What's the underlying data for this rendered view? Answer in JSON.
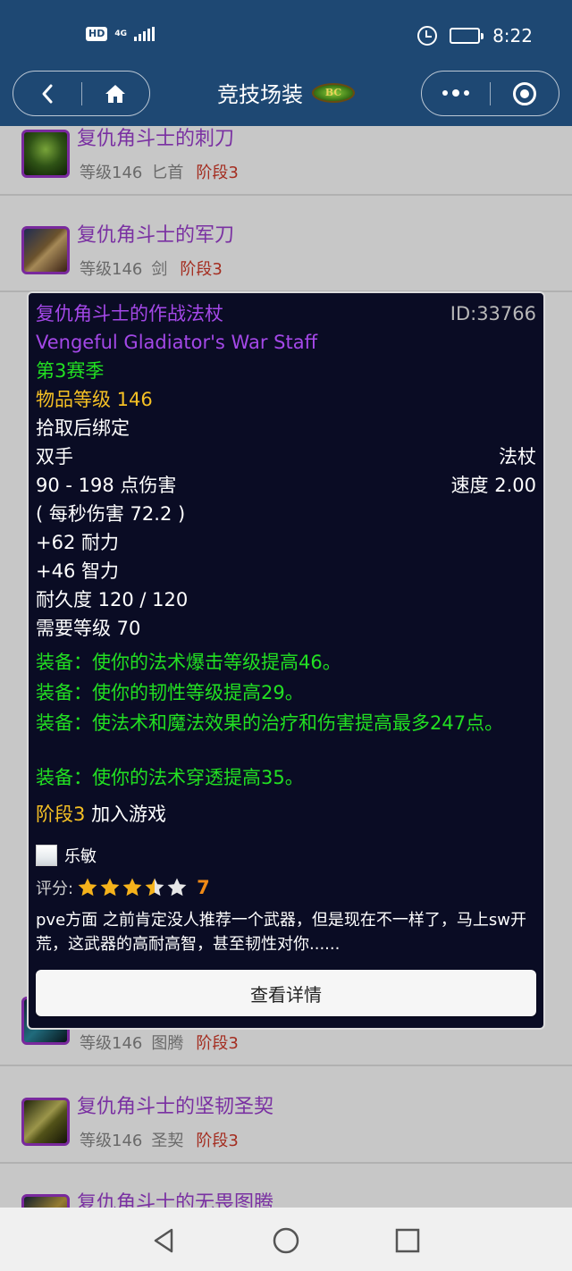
{
  "status_bar": {
    "hd": "HD",
    "network": "4G",
    "time": "8:22"
  },
  "nav": {
    "title": "竞技场装",
    "logo_text": "BC"
  },
  "list": [
    {
      "name": "复仇角斗士的刺刀",
      "level": "等级146",
      "type": "匕首",
      "stage": "阶段3"
    },
    {
      "name": "复仇角斗士的军刀",
      "level": "等级146",
      "type": "剑",
      "stage": "阶段3"
    },
    {
      "name": "",
      "level": "等级146",
      "type": "图腾",
      "stage": "阶段3"
    },
    {
      "name": "复仇角斗士的坚韧圣契",
      "level": "等级146",
      "type": "圣契",
      "stage": "阶段3"
    },
    {
      "name": "复仇角斗士的无畏图腾",
      "level": "",
      "type": "",
      "stage": ""
    }
  ],
  "tooltip": {
    "name_cn": "复仇角斗士的作战法杖",
    "id": "ID:33766",
    "name_en": "Vengeful Gladiator's War Staff",
    "season": "第3赛季",
    "item_level": "物品等级 146",
    "bind": "拾取后绑定",
    "slot": "双手",
    "weapon_type": "法杖",
    "damage": "90 - 198 点伤害",
    "speed": "速度 2.00",
    "dps": "( 每秒伤害 72.2 )",
    "stamina": "+62 耐力",
    "intellect": "+46 智力",
    "durability": "耐久度 120 / 120",
    "required_level": "需要等级 70",
    "equip": [
      "装备：使你的法术爆击等级提高46。",
      "装备：使你的韧性等级提高29。",
      "装备：使法术和魔法效果的治疗和伤害提高最多247点。",
      "装备：使你的法术穿透提高35。"
    ],
    "stage_label": "阶段3",
    "stage_text": "加入游戏",
    "author": "乐敏",
    "rating_label": "评分:",
    "rating_score": "7",
    "rating_stars": 3.5,
    "review": "pve方面 之前肯定没人推荐一个武器，但是现在不一样了，马上sw开荒，这武器的高耐高智，甚至韧性对你......",
    "detail_button": "查看详情"
  },
  "colors": {
    "header": "#1e4873",
    "item_name": "#9d3fd0",
    "stage": "#d23a2a",
    "tooltip_bg": "#0a0c24",
    "equip_green": "#22e022",
    "gold": "#f5c024",
    "score": "#f08a16"
  }
}
